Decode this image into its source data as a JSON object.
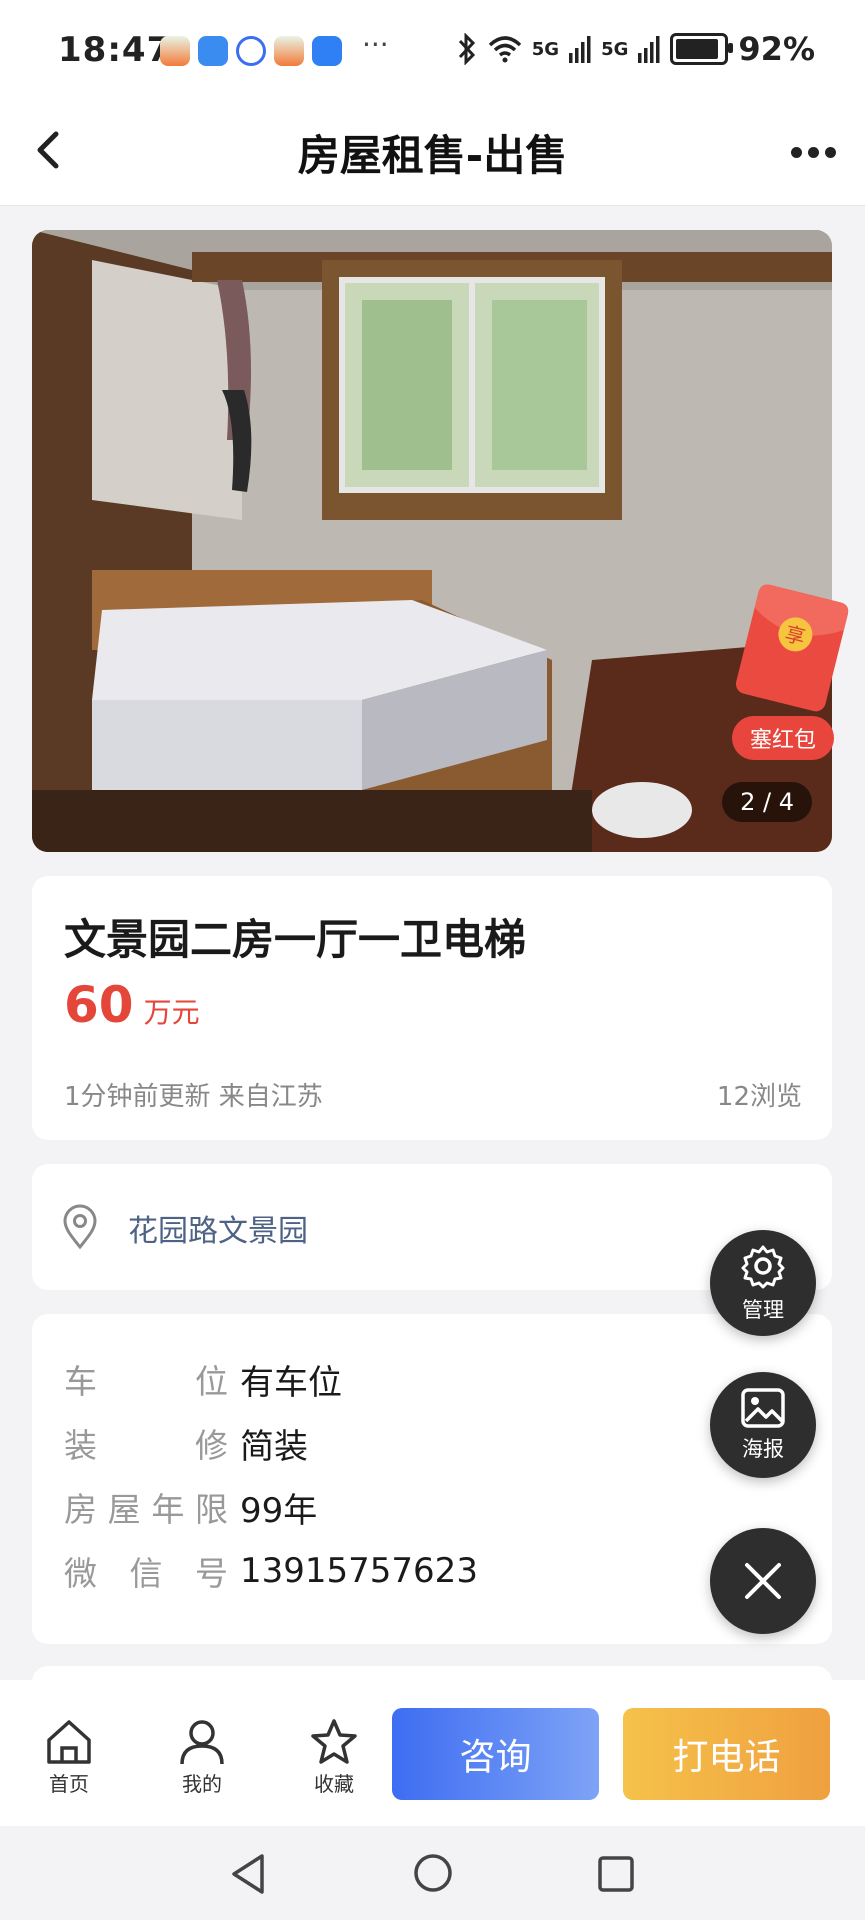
{
  "status_bar": {
    "time": "18:47",
    "more": "···",
    "signal_label_1": "5G",
    "signal_label_2": "5G",
    "battery_level": 0.92,
    "battery_pct": "92%"
  },
  "header": {
    "title": "房屋租售-出售"
  },
  "photo": {
    "counter": "2 / 4"
  },
  "red_packet": {
    "badge_char": "享",
    "label": "塞红包"
  },
  "listing": {
    "title": "文景园二房一厅一卫电梯",
    "price": "60",
    "price_unit": "万元",
    "meta": "1分钟前更新 来自江苏",
    "views": "12浏览"
  },
  "address": {
    "text": "花园路文景园"
  },
  "details": [
    {
      "label_chars": [
        "车",
        "位"
      ],
      "value": "有车位"
    },
    {
      "label_chars": [
        "装",
        "修"
      ],
      "value": "简装"
    },
    {
      "label_chars": [
        "房",
        "屋",
        "年",
        "限"
      ],
      "value": "99年"
    },
    {
      "label_chars": [
        "微",
        "信",
        "号"
      ],
      "value": "13915757623"
    }
  ],
  "fabs": {
    "manage": "管理",
    "poster": "海报"
  },
  "bottom_nav": {
    "home": "首页",
    "mine": "我的",
    "favorite": "收藏",
    "consult": "咨询",
    "call": "打电话"
  },
  "colors": {
    "price_red": "#e4463a",
    "address_blue": "#4d6285",
    "consult_blue": "#3d6df2",
    "call_orange": "#f0a040"
  }
}
